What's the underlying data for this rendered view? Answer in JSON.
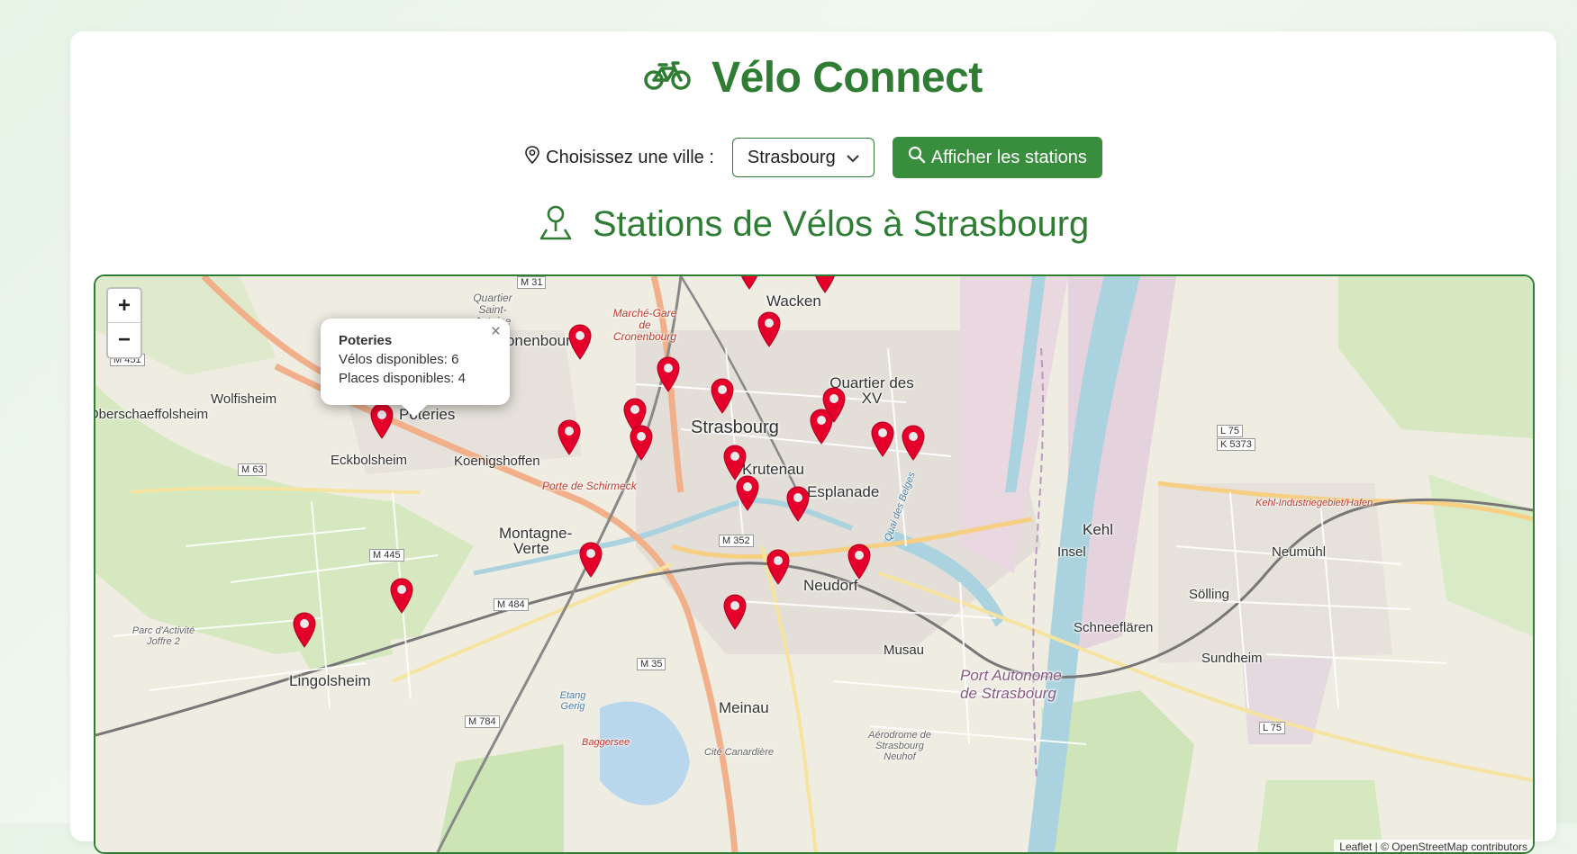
{
  "header": {
    "title": "Vélo Connect",
    "icon": "bicycle-icon"
  },
  "city_selector": {
    "label": "Choisissez une ville :",
    "selected": "Strasbourg",
    "button_label": "Afficher les stations"
  },
  "section_title": "Stations de Vélos à Strasbourg",
  "map": {
    "zoom_in": "+",
    "zoom_out": "−",
    "popup": {
      "name": "Poteries",
      "bikes": "Vélos disponibles: 6",
      "places": "Places disponibles: 4",
      "close": "×"
    },
    "attribution": "Leaflet | © OpenStreetMap contributors",
    "place_labels": [
      "Wacken",
      "Quartier Saint-Antoine",
      "Cronenbourg",
      "Marché-Gare de Cronenbourg",
      "Quartier des XV",
      "Wolfisheim",
      "Oberschaeffolsheim",
      "Poteries",
      "Strasbourg",
      "Eckbolsheim",
      "Koenigshoffen",
      "Krutenau",
      "Esplanade",
      "Porte de Schirmeck",
      "Montagne-Verte",
      "Kehl",
      "Insel",
      "Neumühl",
      "Sölling",
      "Schneeflären",
      "Sundheim",
      "Neudorf",
      "Musau",
      "Port Autonome de Strasbourg",
      "Lingolsheim",
      "Meinau",
      "Parc d'Activité Joffre 2",
      "Etang Gerig",
      "Aérodrome de Strasbourg Neuhof",
      "Cité Canardière",
      "Baggersee",
      "Kehl-Industriegebiet/Hafen",
      "Quai des Belges"
    ],
    "road_labels": [
      "M 31",
      "M 451",
      "M 63",
      "M 445",
      "M 484",
      "M 352",
      "M 35",
      "M 784",
      "L 75",
      "K 5373",
      "L 75"
    ],
    "markers_count": 24
  },
  "colors": {
    "brand": "#2e7d32",
    "button": "#388e3c",
    "marker": "#e4002b"
  }
}
